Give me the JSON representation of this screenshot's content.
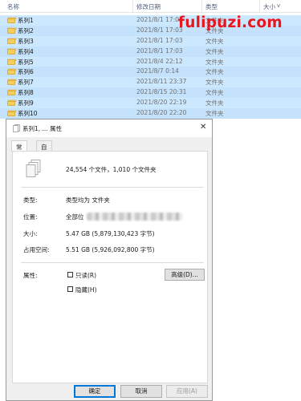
{
  "explorer": {
    "columns": {
      "name": "名称",
      "date": "修改日期",
      "type": "类型",
      "size": "大小"
    },
    "rows": [
      {
        "name": "系列1",
        "date": "2021/8/1 17:02",
        "type": "文件夹"
      },
      {
        "name": "系列2",
        "date": "2021/8/1 17:03",
        "type": "文件夹"
      },
      {
        "name": "系列3",
        "date": "2021/8/1 17:03",
        "type": "文件夹"
      },
      {
        "name": "系列4",
        "date": "2021/8/1 17:03",
        "type": "文件夹"
      },
      {
        "name": "系列5",
        "date": "2021/8/4 22:12",
        "type": "文件夹"
      },
      {
        "name": "系列6",
        "date": "2021/8/7 0:14",
        "type": "文件夹"
      },
      {
        "name": "系列7",
        "date": "2021/8/11 23:37",
        "type": "文件夹"
      },
      {
        "name": "系列8",
        "date": "2021/8/15 20:31",
        "type": "文件夹"
      },
      {
        "name": "系列9",
        "date": "2021/8/20 22:19",
        "type": "文件夹"
      },
      {
        "name": "系列10",
        "date": "2021/8/20 22:20",
        "type": "文件夹"
      }
    ],
    "watermark": "fulipuzi.com"
  },
  "dialog": {
    "title": "系列1, ... 属性",
    "tabs": [
      "常规",
      "自定义"
    ],
    "count": "24,554 个文件，1,010 个文件夹",
    "type_label": "类型:",
    "type_value": "类型均为 文件夹",
    "location_label": "位置:",
    "location_value": "全部位",
    "size_label": "大小:",
    "size_value": "5.47 GB (5,879,130,423 字节)",
    "disk_label": "占用空间:",
    "disk_value": "5.51 GB (5,926,092,800 字节)",
    "attr_label": "属性:",
    "readonly_label": "只读(R)",
    "hidden_label": "隐藏(H)",
    "advanced_label": "高级(D)...",
    "ok_label": "确定",
    "cancel_label": "取消",
    "apply_label": "应用(A)"
  },
  "colors": {
    "selection": "#cce8ff",
    "watermark": "#e8161e",
    "accent": "#0078d7"
  }
}
